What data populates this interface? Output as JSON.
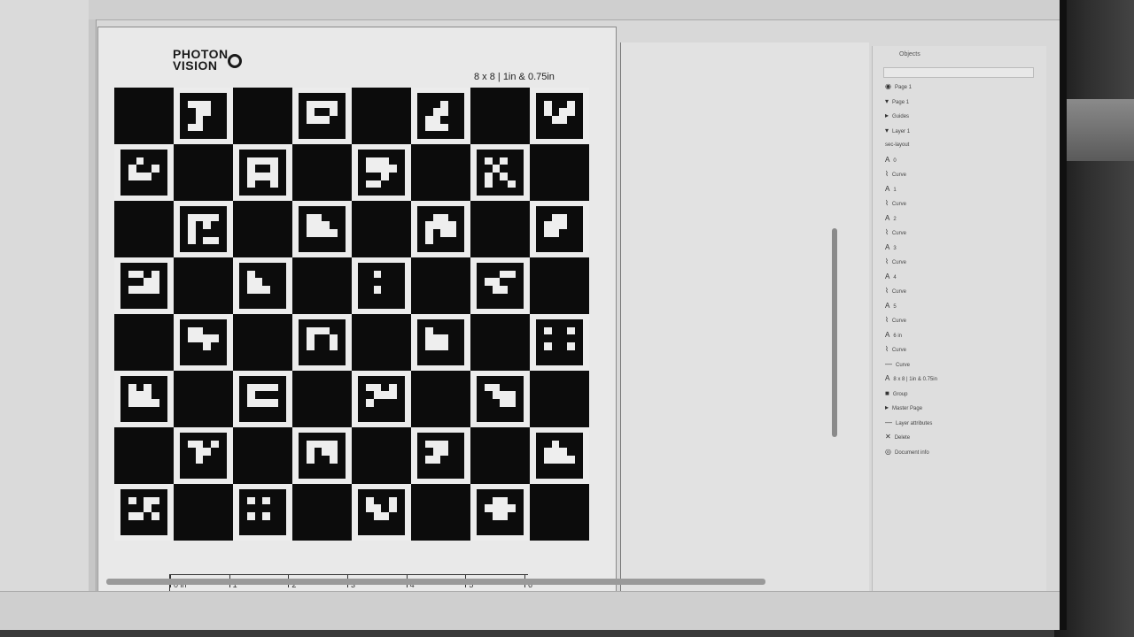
{
  "logo": {
    "line1": "PHOTON",
    "line2": "VISION"
  },
  "board_label": "8 x 8 | 1in & 0.75in",
  "board": {
    "rows": 8,
    "cols": 8,
    "tag_patterns": [
      "000000011100001100001000011000000000",
      "000000011110010010011100000000000000",
      "000000000100001100011000011100000000",
      "000000010010010110001100000000000000",
      "000000001000010010011100000000000000",
      "000000011110010010011110010010000000",
      "000000011100011110000100011000000000",
      "000000010100001000010100010010000000",
      "000000011110010100010000010110000000",
      "000000011000011100011110000000000000",
      "000000001100011110010110010000000000",
      "000000001100011100011000000000000000",
      "000000011010000110011110000000000000",
      "000000010000011000011100000000000000",
      "000000001000000000001000000000000000",
      "000000000110011000001100000000000000",
      "000000011000011110000100000000000000",
      "000000011100010010010010000000000000",
      "000000010000011100011100000000000000",
      "000000010010000000010010000000000000",
      "000000010100011100011110000000000000",
      "000000011110010000011110000000000000",
      "000000011010001110010000000000000000",
      "000000011000001110000110000000000000",
      "000000011010001100001000000000000000",
      "000000011110010110010010000000000000",
      "000000011100001100011000000000000000",
      "000000001000011100011110000000000000",
      "000000010110000100011010000000000000",
      "000000010100000000010100000000000000",
      "000000010010011010001100000000000000",
      "000000001100011110001100000000000000"
    ]
  },
  "ruler_bottom": {
    "ticks": [
      "0 in",
      "1",
      "2",
      "3",
      "4",
      "5",
      "6"
    ]
  },
  "panel": {
    "title": "Objects",
    "rows": [
      {
        "glyph": "◉",
        "label": "Page 1"
      },
      {
        "glyph": "▾",
        "label": "Page 1"
      },
      {
        "glyph": "▸",
        "label": "Guides"
      },
      {
        "glyph": "▾",
        "label": "Layer 1"
      },
      {
        "glyph": "",
        "label": "sec-layout"
      },
      {
        "glyph": "A",
        "label": "0"
      },
      {
        "glyph": "⌇",
        "label": "Curve"
      },
      {
        "glyph": "A",
        "label": "1"
      },
      {
        "glyph": "⌇",
        "label": "Curve"
      },
      {
        "glyph": "A",
        "label": "2"
      },
      {
        "glyph": "⌇",
        "label": "Curve"
      },
      {
        "glyph": "A",
        "label": "3"
      },
      {
        "glyph": "⌇",
        "label": "Curve"
      },
      {
        "glyph": "A",
        "label": "4"
      },
      {
        "glyph": "⌇",
        "label": "Curve"
      },
      {
        "glyph": "A",
        "label": "5"
      },
      {
        "glyph": "⌇",
        "label": "Curve"
      },
      {
        "glyph": "A",
        "label": "6 in"
      },
      {
        "glyph": "⌇",
        "label": "Curve"
      },
      {
        "glyph": "—",
        "label": "Curve"
      },
      {
        "glyph": "A",
        "label": "8 x 8 | 1in & 0.75in"
      },
      {
        "glyph": "■",
        "label": "Group"
      },
      {
        "glyph": "▸",
        "label": "Master Page"
      },
      {
        "glyph": "—",
        "label": "Layer attributes"
      },
      {
        "glyph": "✕",
        "label": "Delete"
      },
      {
        "glyph": "◎",
        "label": "Document info"
      }
    ]
  }
}
